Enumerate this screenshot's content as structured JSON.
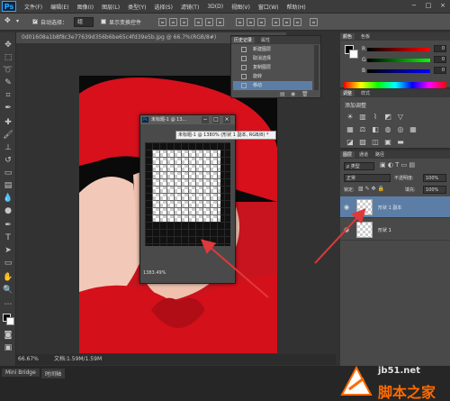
{
  "app": {
    "logo": "Ps"
  },
  "menu": [
    "文件(F)",
    "编辑(E)",
    "图像(I)",
    "图层(L)",
    "类型(Y)",
    "选择(S)",
    "滤镜(T)",
    "3D(D)",
    "视图(V)",
    "窗口(W)",
    "帮助(H)"
  ],
  "window_controls": [
    "−",
    "□",
    "×"
  ],
  "options": {
    "auto_select_label": "自动选择：",
    "auto_select_value": "组",
    "show_transform_label": "显示变换控件"
  },
  "doc_tab": "0d01608a1b8f8c3e77639d356b6be65c4fd39e5b.jpg @ 66.7%(RGB/8#)",
  "status": {
    "zoom": "66.67%",
    "doc": "文档:1.59M/1.59M"
  },
  "bottom_tabs": [
    "Mini Bridge",
    "时间轴"
  ],
  "float_window": {
    "title": "未标题-1 @ 13...",
    "tooltip": "未标题-1 @ 1380% (形状 1 副本, RGB/8) *",
    "zoom": "1383.49%"
  },
  "history": {
    "tabs": [
      "历史记录",
      "属性"
    ],
    "items": [
      "新建图层",
      "取消选择",
      "复制图层",
      "旋转",
      "移动"
    ],
    "selected": 4
  },
  "color_panel": {
    "tabs": [
      "颜色",
      "色板"
    ],
    "rows": [
      {
        "label": "R",
        "value": "0"
      },
      {
        "label": "G",
        "value": "0"
      },
      {
        "label": "B",
        "value": "0"
      }
    ]
  },
  "adjust_panel": {
    "tabs": [
      "调整",
      "样式"
    ],
    "title": "添加调整"
  },
  "layers_panel": {
    "tabs": [
      "图层",
      "通道",
      "路径"
    ],
    "kind_filter": "ρ 类型",
    "blend_mode": "正常",
    "opacity_label": "不透明度:",
    "opacity_value": "100%",
    "lock_label": "锁定:",
    "fill_label": "填充:",
    "fill_value": "100%",
    "layers": [
      {
        "name": "形状 1 副本",
        "selected": true
      },
      {
        "name": "形状 1",
        "selected": false
      }
    ]
  },
  "watermark": {
    "url": "jb51.net",
    "text": "脚本之家"
  },
  "colors": {
    "accent": "#5c7ea6",
    "canvas_red": "#c8141e",
    "arrow": "#e0393b",
    "watermark_orange": "#ff6a00"
  }
}
